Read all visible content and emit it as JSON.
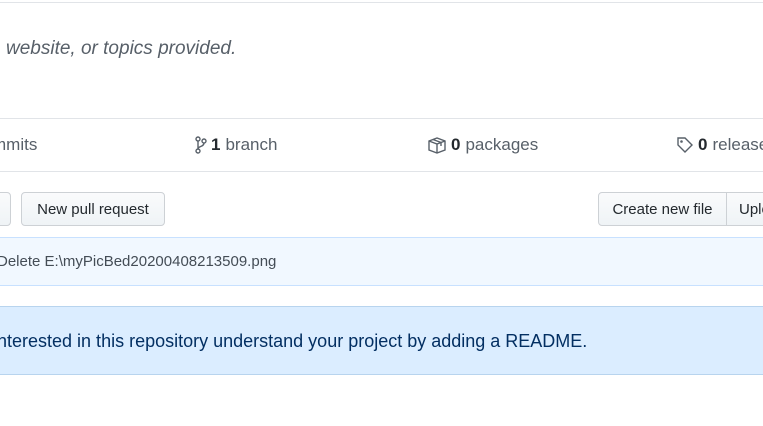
{
  "description": {
    "text": "website, or topics provided."
  },
  "summary": {
    "commits": {
      "count": "",
      "label": "mmits"
    },
    "branches": {
      "count": "1",
      "label": "branch",
      "icon": "branch-icon"
    },
    "packages": {
      "count": "0",
      "label": "packages",
      "icon": "package-icon"
    },
    "releases": {
      "count": "0",
      "label": "releases",
      "icon": "tag-icon"
    }
  },
  "toolbar": {
    "new_pull_request": "New pull request",
    "create_new_file": "Create new file",
    "upload_files": "Upload files"
  },
  "commit": {
    "message": "Delete E:\\myPicBed20200408213509.png"
  },
  "readme_notice": {
    "text": "nterested in this repository understand your project by adding a README."
  },
  "colors": {
    "border": "#e1e4e8",
    "commit_bg": "#f1f8ff",
    "notice_bg": "#dbedff",
    "notice_text": "#032f62"
  }
}
